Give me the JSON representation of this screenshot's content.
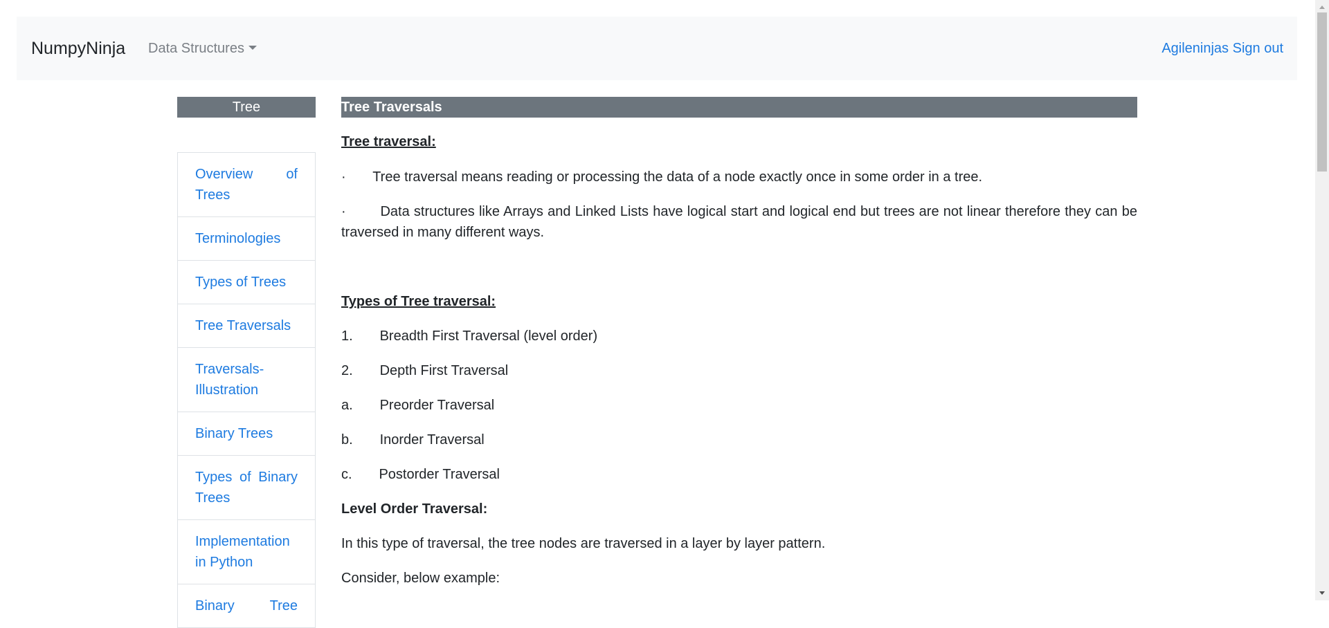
{
  "navbar": {
    "brand": "NumpyNinja",
    "dropdown_label": "Data Structures",
    "user": "Agileninjas",
    "signout": "Sign out"
  },
  "sidebar": {
    "heading": "Tree",
    "items": [
      {
        "label": "Overview of Trees"
      },
      {
        "label": "Terminologies"
      },
      {
        "label": "Types of Trees"
      },
      {
        "label": "Tree Traversals"
      },
      {
        "label": "Traversals-Illustration"
      },
      {
        "label": "Binary Trees"
      },
      {
        "label": "Types of Binary Trees"
      },
      {
        "label": "Implementation in Python"
      },
      {
        "label": "Binary Tree"
      }
    ]
  },
  "main": {
    "heading": "Tree Traversals",
    "section1_title": "Tree traversal:",
    "bullet1": "·       Tree traversal means reading or processing the data of a node exactly once in some order in a tree.",
    "bullet2": "·        Data structures like Arrays and Linked Lists have logical start and logical end but trees are not linear therefore they can be traversed in many different ways.",
    "section2_title": "Types of Tree traversal:",
    "items": [
      "1.       Breadth First Traversal (level order)",
      "2.       Depth First Traversal",
      "a.       Preorder Traversal",
      "b.       Inorder Traversal",
      "c.       Postorder Traversal"
    ],
    "section3_title": "Level Order Traversal:",
    "para1": "In this type of traversal, the tree nodes are traversed in a layer by layer pattern.",
    "para2": "Consider, below example:"
  },
  "colors": {
    "navbar_bg": "#f8f9fa",
    "link": "#1e7be0",
    "heading_bar": "#6c757d"
  }
}
